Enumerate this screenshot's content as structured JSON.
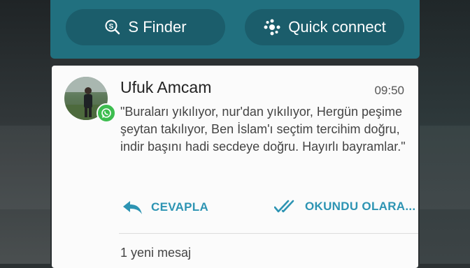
{
  "quick_settings": {
    "finder_label": "S Finder",
    "quick_connect_label": "Quick connect"
  },
  "notification": {
    "sender": "Ufuk Amcam",
    "time": "09:50",
    "message": "\"Buraları yıkılıyor, nur'dan yıkılıyor, Hergün peşime şeytan takılıyor, Ben İslam'ı seçtim tercihim doğru, indir başını hadi secdeye doğru. Hayırlı bayramlar.\"",
    "actions": {
      "reply": "CEVAPLA",
      "mark_read": "OKUNDU OLARA..."
    },
    "footer": "1 yeni mesaj",
    "app_icon": "whatsapp-icon"
  },
  "colors": {
    "panel": "#21707f",
    "action_accent": "#2d94b3",
    "whatsapp_green": "#3dbd4f"
  }
}
